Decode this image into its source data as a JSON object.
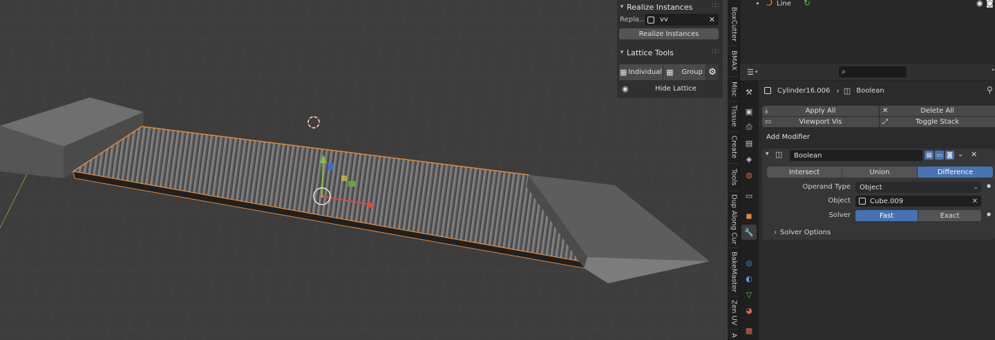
{
  "npanel": {
    "realize_instances": {
      "title": "Realize Instances",
      "replace_label": "Repla...",
      "replace_value": "vv",
      "button": "Realize Instances"
    },
    "lattice_tools": {
      "title": "Lattice Tools",
      "individual": "Individual",
      "group": "Group",
      "hide_lattice": "Hide Lattice"
    }
  },
  "vertical_tabs": [
    "BoxCutter",
    "BMAX",
    "Misc",
    "Tissue",
    "Create",
    "Tools",
    "Dup Along Cur",
    "BakeMaster",
    "Zen UV",
    "A"
  ],
  "outliner": {
    "item_name": "Line"
  },
  "properties": {
    "search_placeholder": "",
    "breadcrumb": {
      "object": "Cylinder16.006",
      "modifier": "Boolean"
    },
    "stack_buttons": {
      "apply_all": "Apply All",
      "delete_all": "Delete All",
      "viewport_vis": "Viewport Vis",
      "toggle_stack": "Toggle Stack"
    },
    "add_modifier": "Add Modifier",
    "modifier": {
      "name": "Boolean",
      "operations": [
        "Intersect",
        "Union",
        "Difference"
      ],
      "selected_operation": "Difference",
      "operand_type_label": "Operand Type",
      "operand_type_value": "Object",
      "object_label": "Object",
      "object_value": "Cube.009",
      "solver_label": "Solver",
      "solver_options": [
        "Fast",
        "Exact"
      ],
      "selected_solver": "Fast",
      "solver_options_label": "Solver Options"
    }
  },
  "colors": {
    "accent": "#4772b3",
    "selection_outline": "#e5893a",
    "viewport_bg": "#3d3d3d"
  }
}
